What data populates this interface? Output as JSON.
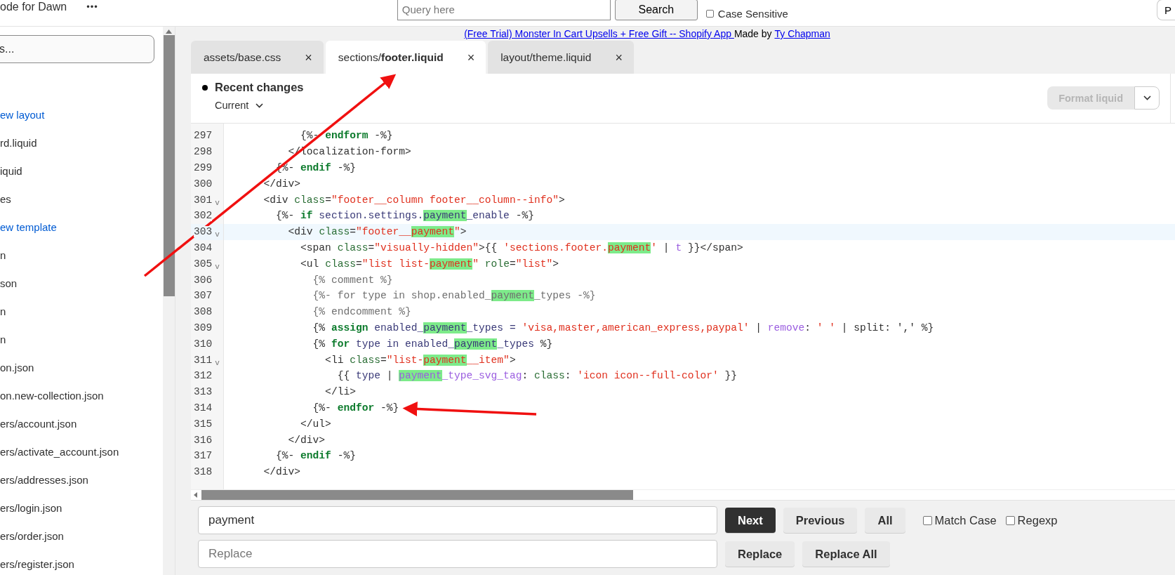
{
  "top_bar": {
    "title": "ode for Dawn",
    "more": "•••",
    "query": {
      "placeholder": "Query here"
    },
    "search_button": "Search",
    "case_sensitive": {
      "label": "Case Sensitive",
      "checked": false
    },
    "right_button": "P"
  },
  "sidebar": {
    "search": {
      "placeholder": "s..."
    },
    "items": [
      {
        "label": "ew layout",
        "kind": "link"
      },
      {
        "label": "rd.liquid",
        "kind": "file"
      },
      {
        "label": "iquid",
        "kind": "file"
      },
      {
        "label": "es",
        "kind": "file"
      },
      {
        "label": "ew template",
        "kind": "link"
      },
      {
        "label": "n",
        "kind": "file"
      },
      {
        "label": "son",
        "kind": "file"
      },
      {
        "label": "n",
        "kind": "file"
      },
      {
        "label": "n",
        "kind": "file"
      },
      {
        "label": "on.json",
        "kind": "file"
      },
      {
        "label": "on.new-collection.json",
        "kind": "file"
      },
      {
        "label": "ers/account.json",
        "kind": "file"
      },
      {
        "label": "ers/activate_account.json",
        "kind": "file"
      },
      {
        "label": "ers/addresses.json",
        "kind": "file"
      },
      {
        "label": "ers/login.json",
        "kind": "file"
      },
      {
        "label": "ers/order.json",
        "kind": "file"
      },
      {
        "label": "ers/register.json",
        "kind": "file"
      }
    ]
  },
  "promo": {
    "link": "(Free Trial) Monster In Cart Upsells + Free Gift -- Shopify App ",
    "made_by": "Made by ",
    "author": "Ty Chapman"
  },
  "tabs": [
    {
      "label": "assets/base.css",
      "selected": false,
      "close": "×"
    },
    {
      "label": "sections/**footer.liquid**",
      "selected": true,
      "close": "×"
    },
    {
      "label": "layout/theme.liquid",
      "selected": false,
      "close": "×"
    }
  ],
  "header": {
    "status": "Recent changes",
    "version": "Current",
    "format_button": {
      "label": "Format liquid",
      "disabled": true
    }
  },
  "code": [
    {
      "n": "297",
      "active": false,
      "tokens": [
        {
          "text": "            {%- ",
          "kind": "delim"
        },
        {
          "text": "endform",
          "kind": "keyword"
        },
        {
          "text": " -%}",
          "kind": "delim"
        }
      ]
    },
    {
      "n": "298",
      "active": false,
      "tokens": [
        {
          "text": "          </localization-form>",
          "kind": "tag"
        }
      ]
    },
    {
      "n": "299",
      "active": false,
      "tokens": [
        {
          "text": "        {%- ",
          "kind": "delim"
        },
        {
          "text": "endif",
          "kind": "keyword"
        },
        {
          "text": " -%}",
          "kind": "delim"
        }
      ]
    },
    {
      "n": "300",
      "active": false,
      "tokens": [
        {
          "text": "      </div>",
          "kind": "tag"
        }
      ]
    },
    {
      "n": "301",
      "fold": "v",
      "active": false,
      "tokens": [
        {
          "text": "      <div ",
          "kind": "tag"
        },
        {
          "text": "class",
          "kind": "attr"
        },
        {
          "text": "=",
          "kind": "tag"
        },
        {
          "text": "\"footer__column footer__column--info\"",
          "kind": "string"
        },
        {
          "text": ">",
          "kind": "tag"
        }
      ]
    },
    {
      "n": "302",
      "active": false,
      "tokens": [
        {
          "text": "        {%- ",
          "kind": "delim"
        },
        {
          "text": "if",
          "kind": "keyword"
        },
        {
          "text": " section.settings.",
          "kind": "var"
        },
        {
          "text": "payment",
          "kind": "var",
          "match": true
        },
        {
          "text": "_enable",
          "kind": "var"
        },
        {
          "text": " -%}",
          "kind": "delim"
        }
      ]
    },
    {
      "n": "303",
      "fold": "v",
      "active": true,
      "tokens": [
        {
          "text": "          <div ",
          "kind": "tag"
        },
        {
          "text": "class",
          "kind": "attr"
        },
        {
          "text": "=",
          "kind": "tag"
        },
        {
          "text": "\"footer__",
          "kind": "string"
        },
        {
          "text": "payment",
          "kind": "string",
          "match": true
        },
        {
          "text": "\"",
          "kind": "string"
        },
        {
          "text": ">",
          "kind": "tag"
        }
      ]
    },
    {
      "n": "304",
      "active": false,
      "tokens": [
        {
          "text": "            <span ",
          "kind": "tag"
        },
        {
          "text": "class",
          "kind": "attr"
        },
        {
          "text": "=",
          "kind": "tag"
        },
        {
          "text": "\"visually-hidden\"",
          "kind": "string"
        },
        {
          "text": ">",
          "kind": "tag"
        },
        {
          "text": "{{ ",
          "kind": "delim"
        },
        {
          "text": "'sections.footer.",
          "kind": "string"
        },
        {
          "text": "payment",
          "kind": "string",
          "match": true
        },
        {
          "text": "'",
          "kind": "string"
        },
        {
          "text": " | ",
          "kind": "delim"
        },
        {
          "text": "t",
          "kind": "filter"
        },
        {
          "text": " }}",
          "kind": "delim"
        },
        {
          "text": "</span>",
          "kind": "tag"
        }
      ]
    },
    {
      "n": "305",
      "fold": "v",
      "active": false,
      "tokens": [
        {
          "text": "            <ul ",
          "kind": "tag"
        },
        {
          "text": "class",
          "kind": "attr"
        },
        {
          "text": "=",
          "kind": "tag"
        },
        {
          "text": "\"list list-",
          "kind": "string"
        },
        {
          "text": "payment",
          "kind": "string",
          "match": true
        },
        {
          "text": "\" ",
          "kind": "string"
        },
        {
          "text": "role",
          "kind": "attr"
        },
        {
          "text": "=",
          "kind": "tag"
        },
        {
          "text": "\"list\"",
          "kind": "string"
        },
        {
          "text": ">",
          "kind": "tag"
        }
      ]
    },
    {
      "n": "306",
      "active": false,
      "tokens": [
        {
          "text": "              {% comment %}",
          "kind": "comment"
        }
      ]
    },
    {
      "n": "307",
      "active": false,
      "tokens": [
        {
          "text": "              {%- for type in shop.enabled_",
          "kind": "comment"
        },
        {
          "text": "payment",
          "kind": "comment",
          "match": true
        },
        {
          "text": "_types -%}",
          "kind": "comment"
        }
      ]
    },
    {
      "n": "308",
      "active": false,
      "tokens": [
        {
          "text": "              {% endcomment %}",
          "kind": "comment"
        }
      ]
    },
    {
      "n": "309",
      "active": false,
      "tokens": [
        {
          "text": "              {% ",
          "kind": "delim"
        },
        {
          "text": "assign",
          "kind": "keyword"
        },
        {
          "text": " enabled_",
          "kind": "var"
        },
        {
          "text": "payment",
          "kind": "var",
          "match": true
        },
        {
          "text": "_types = ",
          "kind": "var"
        },
        {
          "text": "'visa,master,american_express,paypal'",
          "kind": "string"
        },
        {
          "text": " | ",
          "kind": "delim"
        },
        {
          "text": "remove",
          "kind": "filter"
        },
        {
          "text": ": ",
          "kind": "delim"
        },
        {
          "text": "' '",
          "kind": "string"
        },
        {
          "text": " | split: ',' %}",
          "kind": "delim"
        }
      ]
    },
    {
      "n": "310",
      "active": false,
      "tokens": [
        {
          "text": "              {% ",
          "kind": "delim"
        },
        {
          "text": "for",
          "kind": "keyword"
        },
        {
          "text": " type in enabled_",
          "kind": "var"
        },
        {
          "text": "payment",
          "kind": "var",
          "match": true
        },
        {
          "text": "_types",
          "kind": "var"
        },
        {
          "text": " %}",
          "kind": "delim"
        }
      ]
    },
    {
      "n": "311",
      "fold": "v",
      "active": false,
      "tokens": [
        {
          "text": "                <li ",
          "kind": "tag"
        },
        {
          "text": "class",
          "kind": "attr"
        },
        {
          "text": "=",
          "kind": "tag"
        },
        {
          "text": "\"list-",
          "kind": "string"
        },
        {
          "text": "payment",
          "kind": "string",
          "match": true
        },
        {
          "text": "__item\"",
          "kind": "string"
        },
        {
          "text": ">",
          "kind": "tag"
        }
      ]
    },
    {
      "n": "312",
      "active": false,
      "tokens": [
        {
          "text": "                  {{ ",
          "kind": "delim"
        },
        {
          "text": "type",
          "kind": "var"
        },
        {
          "text": " | ",
          "kind": "delim"
        },
        {
          "text": "payment",
          "kind": "filter",
          "match": true
        },
        {
          "text": "_type_svg_tag",
          "kind": "filter"
        },
        {
          "text": ": ",
          "kind": "delim"
        },
        {
          "text": "class",
          "kind": "attr"
        },
        {
          "text": ": ",
          "kind": "delim"
        },
        {
          "text": "'icon icon--full-color'",
          "kind": "string"
        },
        {
          "text": " }}",
          "kind": "delim"
        }
      ]
    },
    {
      "n": "313",
      "active": false,
      "tokens": [
        {
          "text": "                </li>",
          "kind": "tag"
        }
      ]
    },
    {
      "n": "314",
      "active": false,
      "tokens": [
        {
          "text": "              {%- ",
          "kind": "delim"
        },
        {
          "text": "endfor",
          "kind": "keyword"
        },
        {
          "text": " -%}",
          "kind": "delim"
        }
      ]
    },
    {
      "n": "315",
      "active": false,
      "tokens": [
        {
          "text": "            </ul>",
          "kind": "tag"
        }
      ]
    },
    {
      "n": "316",
      "active": false,
      "tokens": [
        {
          "text": "          </div>",
          "kind": "tag"
        }
      ]
    },
    {
      "n": "317",
      "active": false,
      "tokens": [
        {
          "text": "        {%- ",
          "kind": "delim"
        },
        {
          "text": "endif",
          "kind": "keyword"
        },
        {
          "text": " -%}",
          "kind": "delim"
        }
      ]
    },
    {
      "n": "318",
      "active": false,
      "tokens": [
        {
          "text": "      </div>",
          "kind": "tag"
        }
      ]
    }
  ],
  "find_bar": {
    "find": {
      "value": "payment"
    },
    "replace": {
      "placeholder": "Replace"
    },
    "buttons": [
      {
        "label": "Next",
        "kind": "primary"
      },
      {
        "label": "Previous",
        "kind": "secondary"
      },
      {
        "label": "All",
        "kind": "secondary"
      }
    ],
    "options": [
      {
        "label": "Match Case",
        "checked": false
      },
      {
        "label": "Regexp",
        "checked": false
      }
    ],
    "replace_buttons": [
      {
        "label": "Replace",
        "kind": "secondary"
      },
      {
        "label": "Replace All",
        "kind": "secondary"
      }
    ]
  }
}
